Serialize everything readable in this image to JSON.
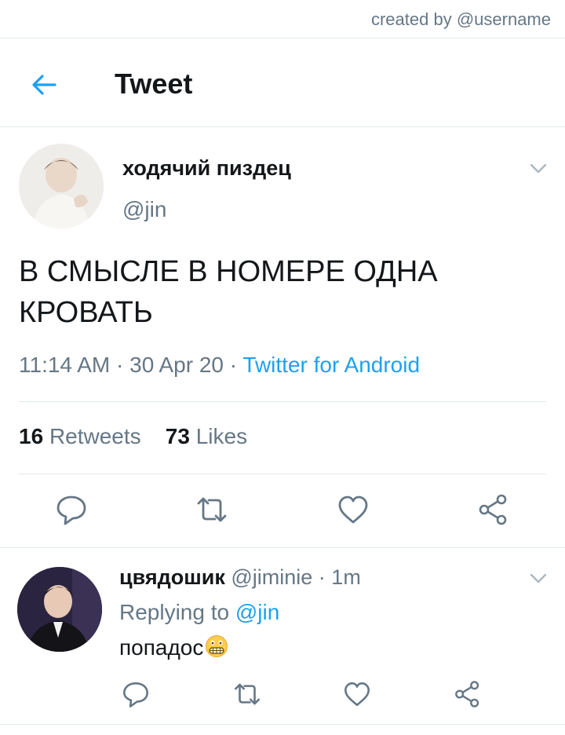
{
  "watermark": "created by @username",
  "header": {
    "title": "Tweet",
    "back_icon": "arrow-left-icon"
  },
  "tweet": {
    "display_name": "ходячий пиздец",
    "handle": "@jin",
    "text": "В СМЫСЛЕ В НОМЕРЕ ОДНА КРОВАТЬ",
    "time": "11:14 AM",
    "separator": " · ",
    "date": "30 Apr 20",
    "source": "Twitter for Android",
    "retweets_count": "16",
    "retweets_label": "Retweets",
    "likes_count": "73",
    "likes_label": "Likes",
    "actions": [
      "reply-icon",
      "retweet-icon",
      "like-icon",
      "share-icon"
    ]
  },
  "reply": {
    "display_name": "цвядошик",
    "handle": "@jiminie",
    "time_separator": " · ",
    "time": "1m",
    "replying_label": "Replying to",
    "replying_handle": "@jin",
    "text": "попадос",
    "emoji": "grimacing-face-emoji",
    "actions": [
      "reply-icon",
      "retweet-icon",
      "like-icon",
      "share-icon"
    ]
  },
  "colors": {
    "accent": "#1da1f2",
    "muted": "#657786",
    "divider": "#e1e8ed",
    "text": "#14171a"
  }
}
